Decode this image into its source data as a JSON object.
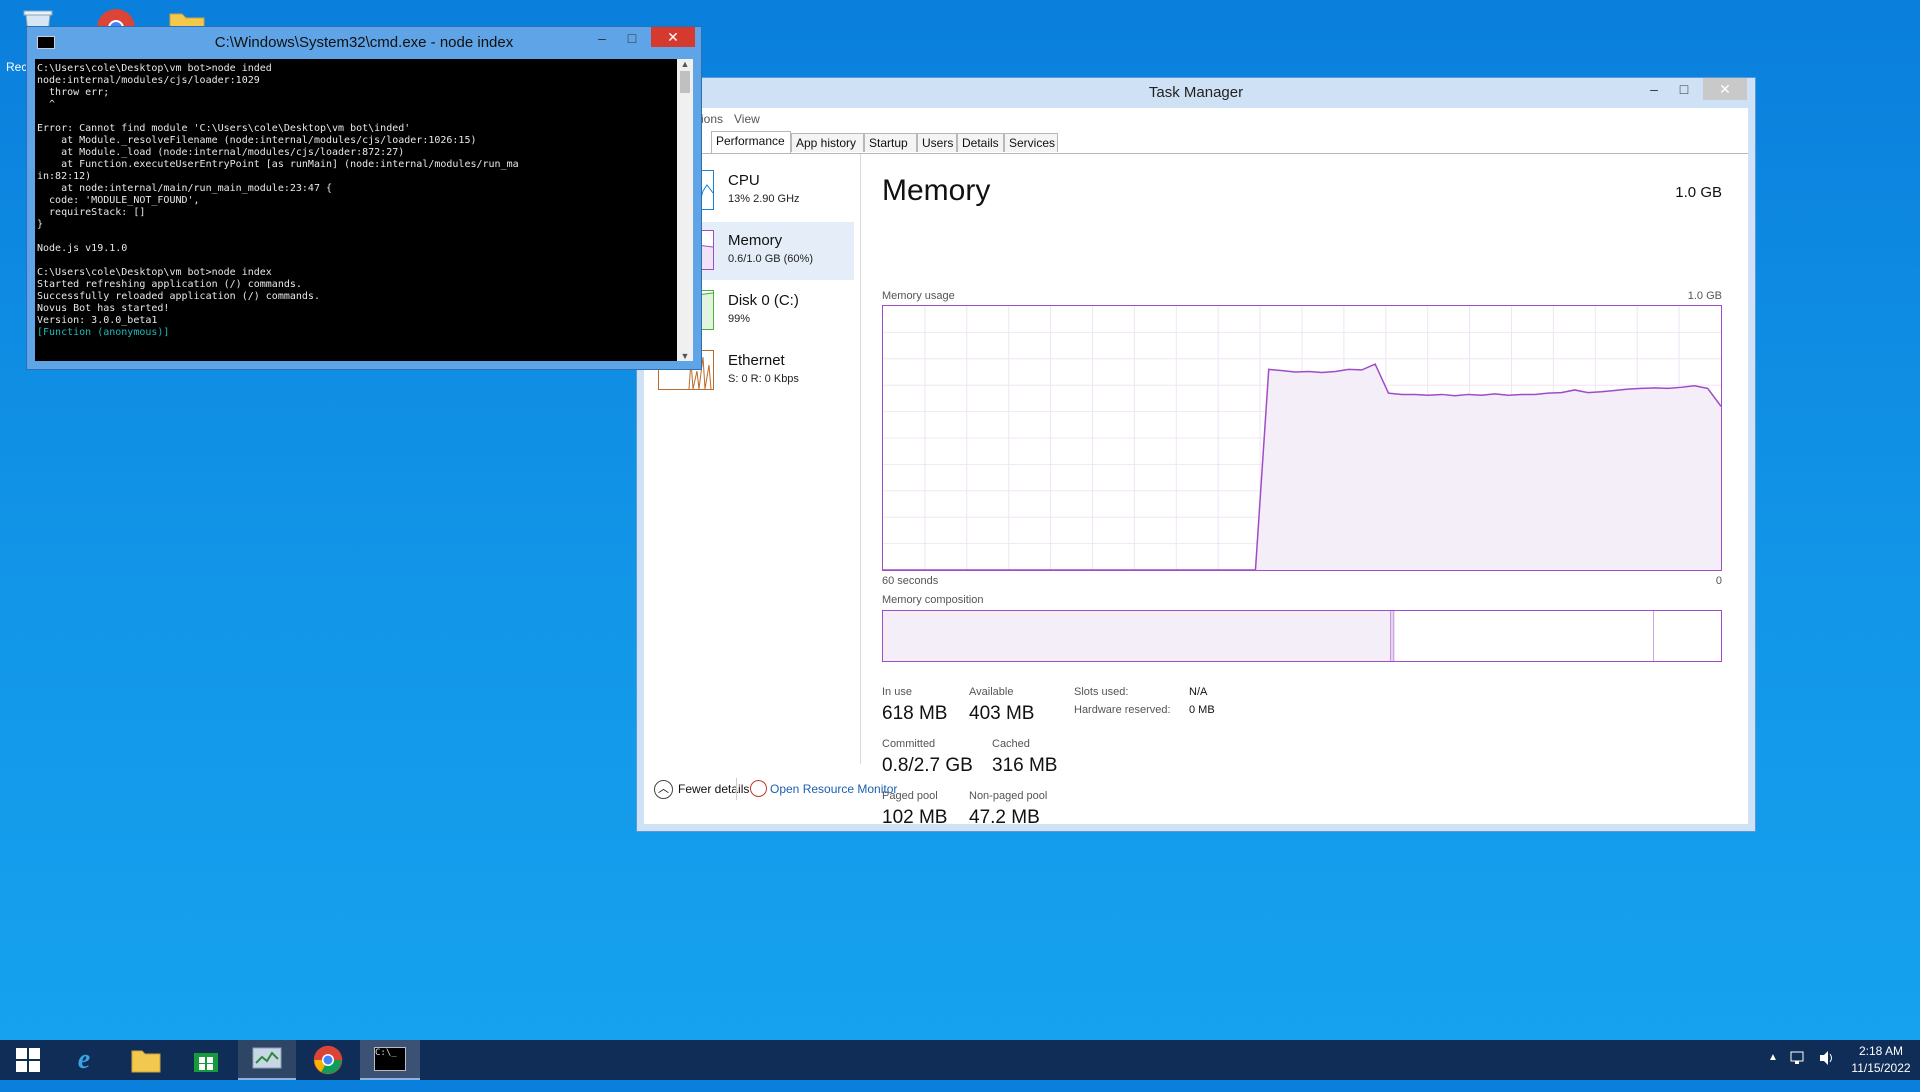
{
  "desktop": {
    "recycle_label": "Rec"
  },
  "cmd": {
    "title": "C:\\Windows\\System32\\cmd.exe - node  index",
    "minimize": "–",
    "maximize": "□",
    "close": "✕",
    "lines": [
      {
        "text": "C:\\Users\\cole\\Desktop\\vm bot>node inded",
        "color": "#e8e8e8"
      },
      {
        "text": "node:internal/modules/cjs/loader:1029",
        "color": "#e8e8e8"
      },
      {
        "text": "  throw err;",
        "color": "#e8e8e8"
      },
      {
        "text": "  ^",
        "color": "#e8e8e8"
      },
      {
        "text": "",
        "color": "#e8e8e8"
      },
      {
        "text": "Error: Cannot find module 'C:\\Users\\cole\\Desktop\\vm bot\\inded'",
        "color": "#e8e8e8"
      },
      {
        "text": "    at Module._resolveFilename (node:internal/modules/cjs/loader:1026:15)",
        "color": "#e8e8e8"
      },
      {
        "text": "    at Module._load (node:internal/modules/cjs/loader:872:27)",
        "color": "#e8e8e8"
      },
      {
        "text": "    at Function.executeUserEntryPoint [as runMain] (node:internal/modules/run_ma",
        "color": "#e8e8e8"
      },
      {
        "text": "in:82:12)",
        "color": "#e8e8e8"
      },
      {
        "text": "    at node:internal/main/run_main_module:23:47 {",
        "color": "#e8e8e8"
      },
      {
        "text": "  code: 'MODULE_NOT_FOUND',",
        "color": "#e8e8e8"
      },
      {
        "text": "  requireStack: []",
        "color": "#e8e8e8"
      },
      {
        "text": "}",
        "color": "#e8e8e8"
      },
      {
        "text": "",
        "color": "#e8e8e8"
      },
      {
        "text": "Node.js v19.1.0",
        "color": "#e8e8e8"
      },
      {
        "text": "",
        "color": "#e8e8e8"
      },
      {
        "text": "C:\\Users\\cole\\Desktop\\vm bot>node index",
        "color": "#e8e8e8"
      },
      {
        "text": "Started refreshing application (/) commands.",
        "color": "#e8e8e8"
      },
      {
        "text": "Successfully reloaded application (/) commands.",
        "color": "#e8e8e8"
      },
      {
        "text": "Novus Bot has started!",
        "color": "#e8e8e8"
      },
      {
        "text": "Version: 3.0.0_beta1",
        "color": "#e8e8e8"
      },
      {
        "text": "[Function (anonymous)]",
        "color": "#1fb8b8"
      }
    ]
  },
  "taskmanager": {
    "title": "Task Manager",
    "minimize": "–",
    "maximize": "□",
    "close": "✕",
    "menu": {
      "options": "ions",
      "view": "View"
    },
    "tabs": [
      "Performance",
      "App history",
      "Startup",
      "Users",
      "Details",
      "Services"
    ],
    "sidebar": [
      {
        "name": "CPU",
        "sub": "13% 2.90 GHz",
        "color": "#1c7fd1"
      },
      {
        "name": "Memory",
        "sub": "0.6/1.0 GB (60%)",
        "color": "#a04cc6"
      },
      {
        "name": "Disk 0 (C:)",
        "sub": "99%",
        "color": "#4caf3c"
      },
      {
        "name": "Ethernet",
        "sub": "S: 0 R: 0 Kbps",
        "color": "#b86b2c"
      }
    ],
    "memory": {
      "heading": "Memory",
      "total": "1.0 GB",
      "usage_label": "Memory usage",
      "usage_max": "1.0 GB",
      "time_left": "60 seconds",
      "time_right": "0",
      "composition_label": "Memory composition",
      "usage_series_fraction": [
        0,
        0,
        0,
        0,
        0,
        0,
        0,
        0,
        0,
        0,
        0,
        0,
        0,
        0,
        0,
        0,
        0,
        0,
        0,
        0,
        0,
        0,
        0,
        0,
        0,
        0,
        0,
        0,
        0,
        0.76,
        0.755,
        0.75,
        0.752,
        0.748,
        0.752,
        0.76,
        0.758,
        0.78,
        0.67,
        0.665,
        0.665,
        0.662,
        0.665,
        0.66,
        0.665,
        0.662,
        0.667,
        0.662,
        0.665,
        0.665,
        0.67,
        0.672,
        0.682,
        0.672,
        0.675,
        0.68,
        0.685,
        0.688,
        0.69,
        0.688,
        0.692,
        0.698,
        0.688,
        0.62
      ],
      "composition_fractions": {
        "in_use": 0.606,
        "modified": 0.004,
        "standby": 0.31,
        "free": 0.08
      },
      "stats": {
        "in_use_label": "In use",
        "in_use": "618 MB",
        "available_label": "Available",
        "available": "403 MB",
        "committed_label": "Committed",
        "committed": "0.8/2.7 GB",
        "cached_label": "Cached",
        "cached": "316 MB",
        "paged_label": "Paged pool",
        "paged": "102 MB",
        "nonpaged_label": "Non-paged pool",
        "nonpaged": "47.2 MB",
        "slots_label": "Slots used:",
        "slots": "N/A",
        "hwres_label": "Hardware reserved:",
        "hwres": "0 MB"
      }
    },
    "footer": {
      "fewer": "Fewer details",
      "monitor": "Open Resource Monitor"
    }
  },
  "taskbar": {
    "time": "2:18 AM",
    "date": "11/15/2022"
  },
  "colors": {
    "memory_accent": "#a04cc6",
    "taskbar": "#0f2d57"
  }
}
